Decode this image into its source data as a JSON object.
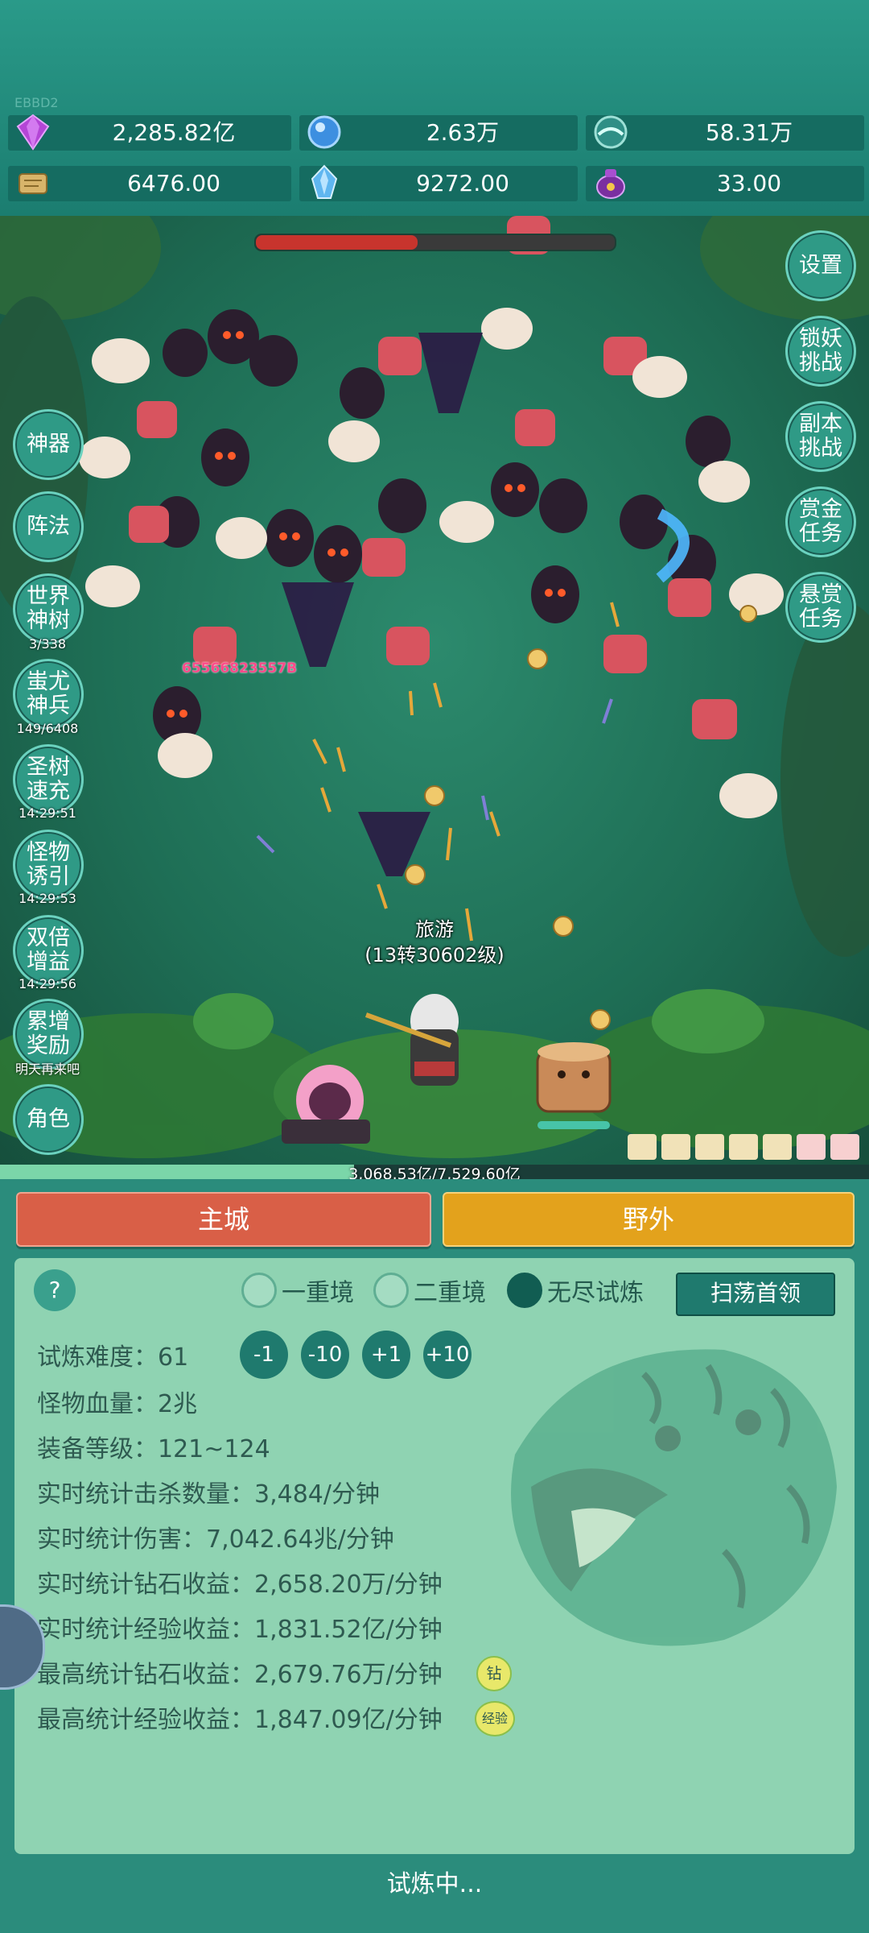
{
  "build_tag": "EBBD2",
  "resources": [
    {
      "icon": "purple-gem-icon",
      "value": "2,285.82亿"
    },
    {
      "icon": "blue-crystal-icon",
      "value": "2.63万"
    },
    {
      "icon": "teal-orb-icon",
      "value": "58.31万"
    },
    {
      "icon": "scroll-icon",
      "value": "6476.00"
    },
    {
      "icon": "ice-shard-icon",
      "value": "9272.00"
    },
    {
      "icon": "purple-pouch-icon",
      "value": "33.00"
    }
  ],
  "boss_hp_fraction": 0.45,
  "left_buttons": [
    {
      "label": "神器",
      "sub": ""
    },
    {
      "label": "阵法",
      "sub": ""
    },
    {
      "label": "世界神树",
      "sub": "3/338"
    },
    {
      "label": "蚩尤神兵",
      "sub": "149/6408"
    },
    {
      "label": "圣树速充",
      "sub": "14:29:51"
    },
    {
      "label": "怪物诱引",
      "sub": "14:29:53"
    },
    {
      "label": "双倍增益",
      "sub": "14:29:56"
    },
    {
      "label": "累增奖励",
      "sub": "明天再来吧"
    },
    {
      "label": "角色",
      "sub": ""
    }
  ],
  "right_buttons": [
    {
      "label": "设置"
    },
    {
      "label": "锁妖挑战"
    },
    {
      "label": "副本挑战"
    },
    {
      "label": "赏金任务"
    },
    {
      "label": "悬赏任务"
    }
  ],
  "damage_number": "65566823557B",
  "player": {
    "name": "旅游",
    "level": "(13转30602级)"
  },
  "exp": {
    "text": "3,068.53亿/7,529.60亿",
    "fraction": 0.4075
  },
  "nav": {
    "main_city": "主城",
    "wild": "野外"
  },
  "tabs": [
    {
      "label": "一重境",
      "selected": false
    },
    {
      "label": "二重境",
      "selected": false
    },
    {
      "label": "无尽试炼",
      "selected": true
    }
  ],
  "help_label": "?",
  "sweep_label": "扫荡首领",
  "difficulty": {
    "label": "试炼难度：",
    "value": "61"
  },
  "adjust_buttons": [
    "-1",
    "-10",
    "+1",
    "+10"
  ],
  "stats": [
    "怪物血量：2兆",
    "装备等级：121~124",
    "实时统计击杀数量：3,484/分钟",
    "实时统计伤害：7,042.64兆/分钟",
    "实时统计钻石收益：2,658.20万/分钟",
    "实时统计经验收益：1,831.52亿/分钟",
    "最高统计钻石收益：2,679.76万/分钟",
    "最高统计经验收益：1,847.09亿/分钟"
  ],
  "stat_badges": {
    "diamond": "钻",
    "exp": "经验"
  },
  "status": "试炼中...",
  "colors": {
    "main_city": "#d95f47",
    "wild": "#e3a21c",
    "accent": "#1f7a6e"
  }
}
